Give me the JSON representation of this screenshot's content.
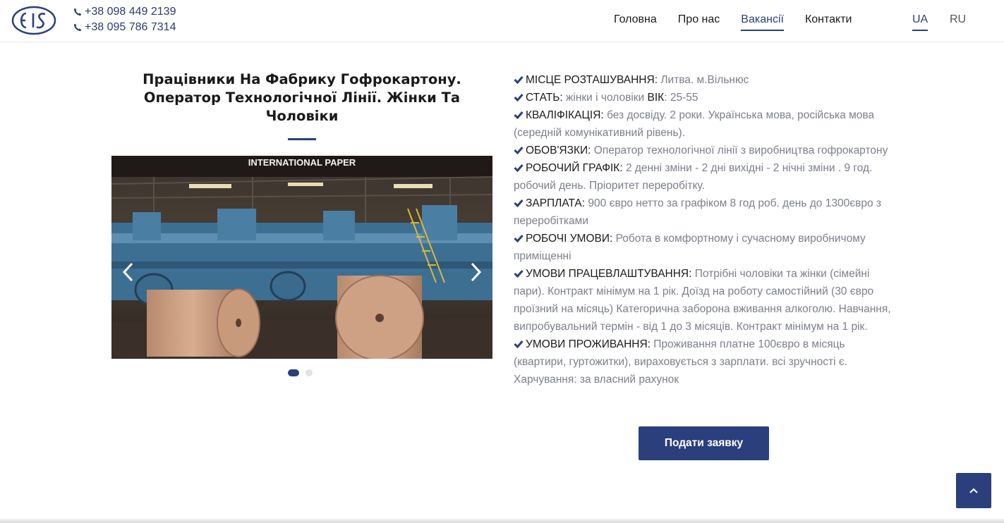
{
  "header": {
    "phones": [
      "+38 098 449 2139",
      "+38 095 786 7314"
    ],
    "nav": [
      {
        "label": "Головна",
        "active": false
      },
      {
        "label": "Про нас",
        "active": false
      },
      {
        "label": "Вакансії",
        "active": true
      },
      {
        "label": "Контакти",
        "active": false
      }
    ],
    "languages": [
      {
        "label": "UA",
        "active": true
      },
      {
        "label": "RU",
        "active": false
      }
    ]
  },
  "job": {
    "title": "Працівники На Фабрику Гофрокартону. Оператор Технологічної Лінії. Жінки Та Чоловіки",
    "carousel": {
      "slide_count": 2,
      "active_slide": 1,
      "image_caption": "INTERNATIONAL PAPER"
    },
    "details": [
      {
        "label": "МІСЦЕ РОЗТАШУВАННЯ",
        "value": "Литва. м.Вільнюс"
      },
      {
        "label": "СТАТЬ",
        "value": "жінки і чоловіки",
        "label2": "ВІК",
        "value2": "25-55"
      },
      {
        "label": "КВАЛІФІКАЦІЯ",
        "value": "без досвіду. 2 роки. Українська мова, російська мова (середній комунікативний рівень)."
      },
      {
        "label": "ОБОВ'ЯЗКИ",
        "value": "Оператор технологічної лінії з виробництва гофрокартону"
      },
      {
        "label": "РОБОЧИЙ ГРАФІК",
        "value": "2 денні зміни - 2 дні вихідні - 2 нічні зміни . 9 год. робочий день. Пріоритет переробітку."
      },
      {
        "label": "ЗАРПЛАТА",
        "value": "900 євро нетто за графіком 8 год роб. день до 1300євро з переробітками"
      },
      {
        "label": "РОБОЧІ УМОВИ",
        "value": "Робота в комфортному і сучасному виробничому приміщенні"
      },
      {
        "label": "УМОВИ ПРАЦЕВЛАШТУВАННЯ",
        "value": "Потрібні чоловіки та жінки (сімейні пари). Контракт мінімум на 1 рік. Доїзд на роботу самостійний (30 євро проїзний на місяць) Категорична заборона вживання алкоголю. Навчання, випробувальний термін - від 1 до 3 місяців. Контракт мінімум на 1 рік."
      },
      {
        "label": "УМОВИ ПРОЖИВАННЯ",
        "value": "Проживання платне 100євро в місяць (квартири, гуртожитки), вираховується з зарплати. всі зручності є. Харчування: за власний рахунок"
      }
    ],
    "apply_label": "Подати заявку"
  },
  "colors": {
    "accent": "#2a3f7c",
    "value_text": "#7b7f89",
    "label_text": "#1a1a1a"
  },
  "icons": {
    "logo": "eis-logo",
    "phone": "phone-icon",
    "check": "check-icon",
    "prev": "chevron-left-icon",
    "next": "chevron-right-icon",
    "to_top": "chevron-up-icon"
  }
}
